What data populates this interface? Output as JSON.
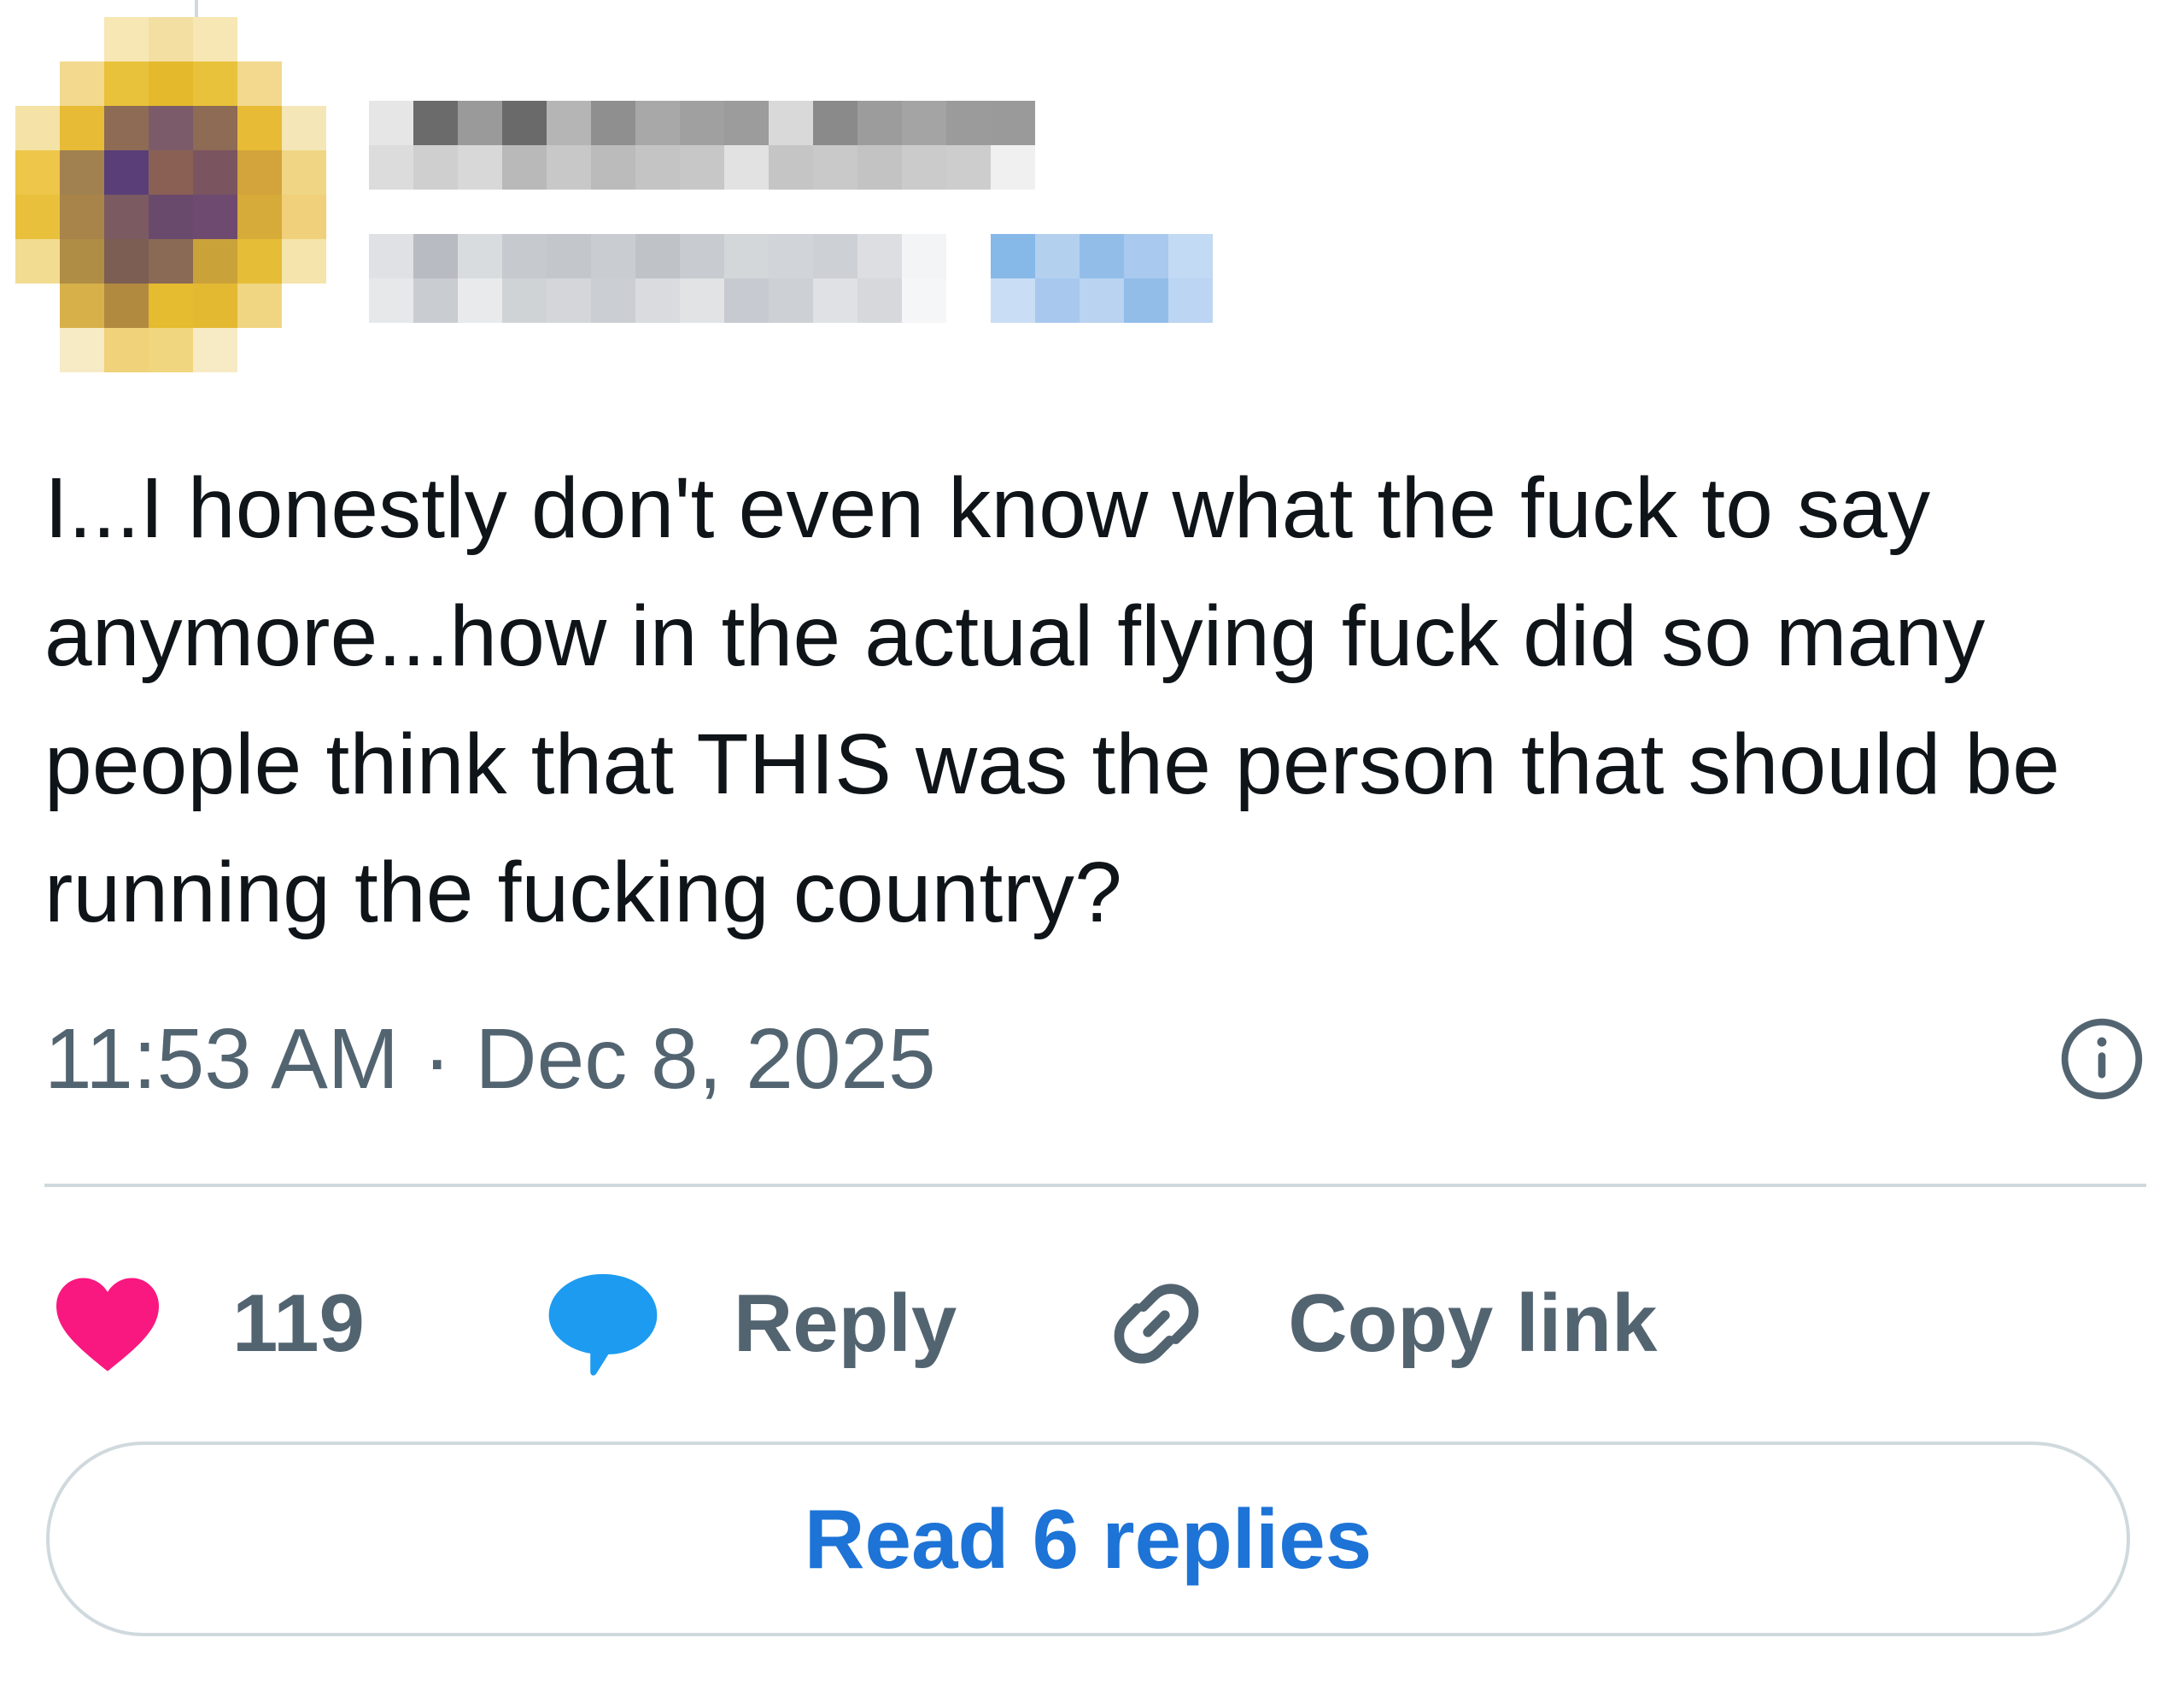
{
  "author": {
    "name_pixelated": "",
    "handle_pixelated": ""
  },
  "tweet": {
    "text": "I...I honestly don't even know what the fuck to say anymore...how in the actual flying fuck did so many people think that THIS was the person that should be running the fucking country?",
    "time": "11:53 AM",
    "separator": "·",
    "date": "Dec 8, 2025"
  },
  "actions": {
    "like_count": "119",
    "reply_label": "Reply",
    "copy_link_label": "Copy link"
  },
  "read_replies_label": "Read 6 replies",
  "colors": {
    "like": "#f91880",
    "reply": "#1d9bf0",
    "secondary_text": "#536471",
    "link": "#1d73d6",
    "border": "#cfd9de"
  },
  "icons": {
    "info": "info-circle-icon",
    "like": "heart-icon",
    "reply": "speech-bubble-icon",
    "copy_link": "link-icon"
  }
}
